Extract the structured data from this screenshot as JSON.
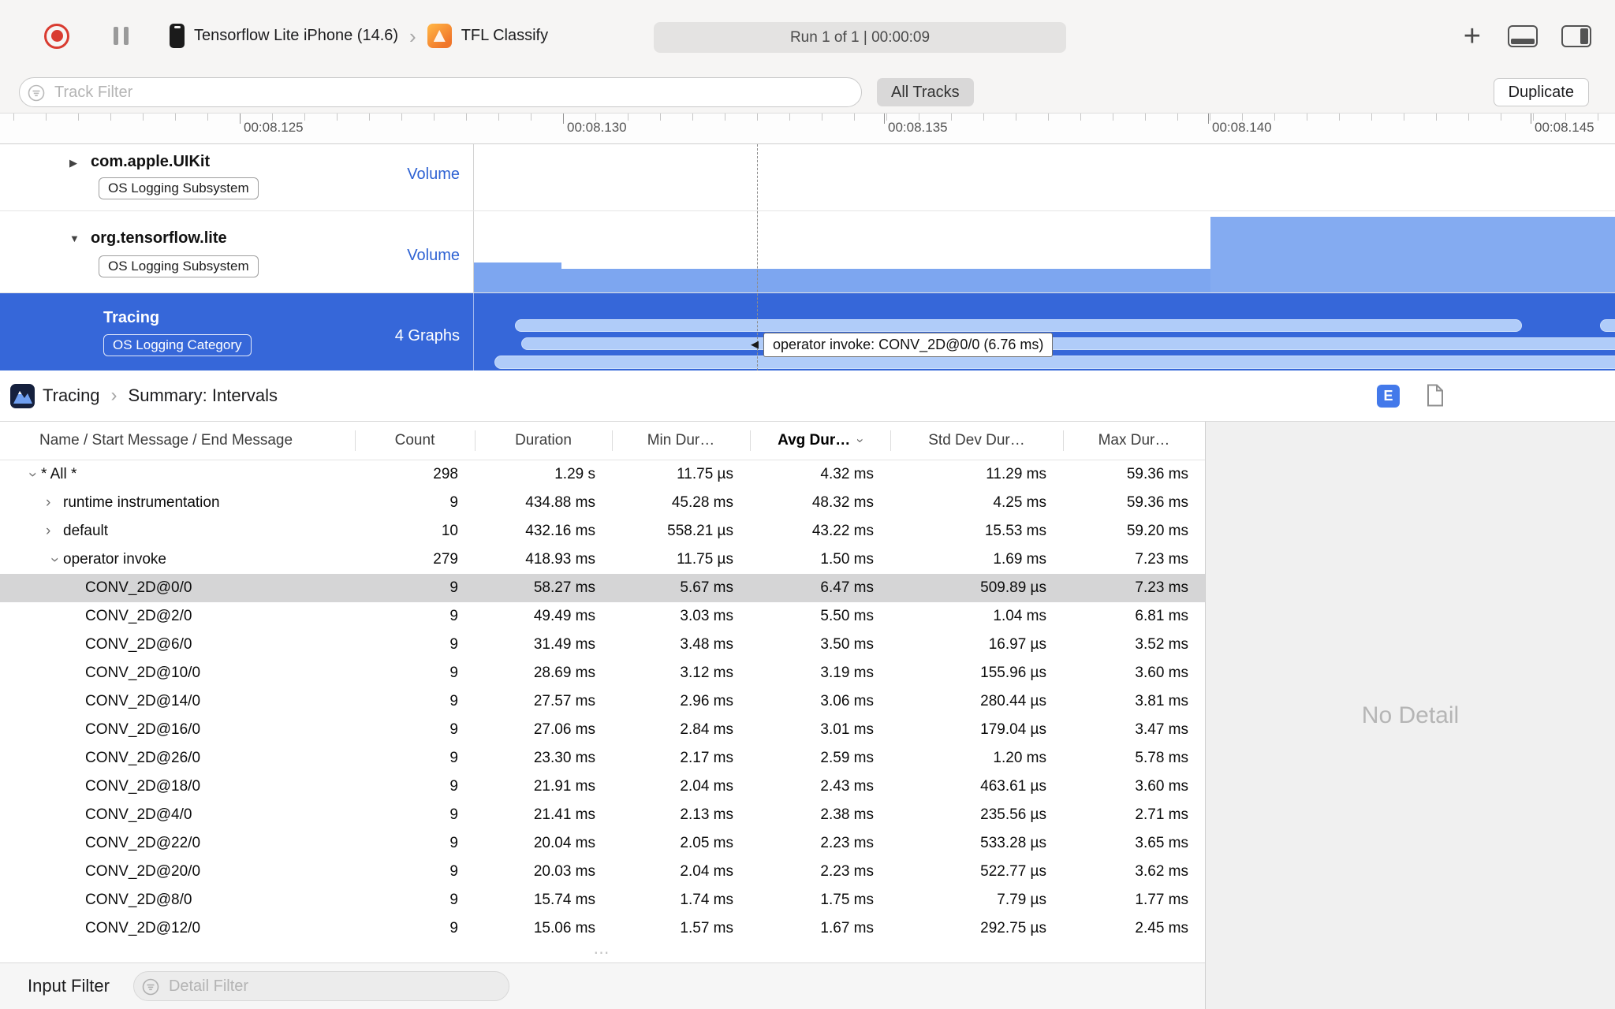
{
  "toolbar": {
    "device_name": "Tensorflow Lite iPhone (14.6)",
    "app_name": "TFL Classify",
    "run_status": "Run 1 of 1  |  00:00:09"
  },
  "filterbar": {
    "track_filter_placeholder": "Track Filter",
    "all_tracks_label": "All Tracks",
    "duplicate_label": "Duplicate"
  },
  "ruler": {
    "ticks": [
      "00:08.125",
      "00:08.130",
      "00:08.135",
      "00:08.140",
      "00:08.145"
    ]
  },
  "tracks": [
    {
      "name": "com.apple.UIKit",
      "badge": "OS Logging Subsystem",
      "meta": "Volume",
      "disclosure": "▶"
    },
    {
      "name": "org.tensorflow.lite",
      "badge": "OS Logging Subsystem",
      "meta": "Volume",
      "disclosure": "▼"
    },
    {
      "name": "Tracing",
      "badge": "OS Logging Category",
      "meta": "4 Graphs",
      "disclosure": ""
    }
  ],
  "timeline": {
    "tooltip": "operator invoke: CONV_2D@0/0 (6.76 ms)"
  },
  "breadcrumb": {
    "instrument": "Tracing",
    "detail": "Summary: Intervals",
    "inspector_button": "E"
  },
  "inspector": {
    "no_detail": "No Detail"
  },
  "statusbar": {
    "input_filter_label": "Input Filter",
    "detail_filter_placeholder": "Detail Filter"
  },
  "colors": {
    "selection_blue": "#3667d9",
    "graph_blue": "#7da6f0",
    "interval_blue": "#b0ccf9",
    "volume_label_blue": "#2e62d3",
    "record_red": "#d93b30"
  },
  "table": {
    "columns": [
      "Name / Start Message / End Message",
      "Count",
      "Duration",
      "Min Dur…",
      "Avg Dur…",
      "Std Dev Dur…",
      "Max Dur…"
    ],
    "sorted_column": "Avg Dur…",
    "rows": [
      {
        "indent": 0,
        "chev": "v",
        "name": "* All *",
        "count": "298",
        "duration": "1.29 s",
        "min": "11.75 µs",
        "avg": "4.32 ms",
        "std": "11.29 ms",
        "max": "59.36 ms",
        "selected": false
      },
      {
        "indent": 1,
        "chev": ">",
        "name": "runtime instrumentation",
        "count": "9",
        "duration": "434.88 ms",
        "min": "45.28 ms",
        "avg": "48.32 ms",
        "std": "4.25 ms",
        "max": "59.36 ms",
        "selected": false
      },
      {
        "indent": 1,
        "chev": ">",
        "name": "default",
        "count": "10",
        "duration": "432.16 ms",
        "min": "558.21 µs",
        "avg": "43.22 ms",
        "std": "15.53 ms",
        "max": "59.20 ms",
        "selected": false
      },
      {
        "indent": 1,
        "chev": "v",
        "name": "operator invoke",
        "count": "279",
        "duration": "418.93 ms",
        "min": "11.75 µs",
        "avg": "1.50 ms",
        "std": "1.69 ms",
        "max": "7.23 ms",
        "selected": false
      },
      {
        "indent": 2,
        "chev": "",
        "name": "CONV_2D@0/0",
        "count": "9",
        "duration": "58.27 ms",
        "min": "5.67 ms",
        "avg": "6.47 ms",
        "std": "509.89 µs",
        "max": "7.23 ms",
        "selected": true
      },
      {
        "indent": 2,
        "chev": "",
        "name": "CONV_2D@2/0",
        "count": "9",
        "duration": "49.49 ms",
        "min": "3.03 ms",
        "avg": "5.50 ms",
        "std": "1.04 ms",
        "max": "6.81 ms",
        "selected": false
      },
      {
        "indent": 2,
        "chev": "",
        "name": "CONV_2D@6/0",
        "count": "9",
        "duration": "31.49 ms",
        "min": "3.48 ms",
        "avg": "3.50 ms",
        "std": "16.97 µs",
        "max": "3.52 ms",
        "selected": false
      },
      {
        "indent": 2,
        "chev": "",
        "name": "CONV_2D@10/0",
        "count": "9",
        "duration": "28.69 ms",
        "min": "3.12 ms",
        "avg": "3.19 ms",
        "std": "155.96 µs",
        "max": "3.60 ms",
        "selected": false
      },
      {
        "indent": 2,
        "chev": "",
        "name": "CONV_2D@14/0",
        "count": "9",
        "duration": "27.57 ms",
        "min": "2.96 ms",
        "avg": "3.06 ms",
        "std": "280.44 µs",
        "max": "3.81 ms",
        "selected": false
      },
      {
        "indent": 2,
        "chev": "",
        "name": "CONV_2D@16/0",
        "count": "9",
        "duration": "27.06 ms",
        "min": "2.84 ms",
        "avg": "3.01 ms",
        "std": "179.04 µs",
        "max": "3.47 ms",
        "selected": false
      },
      {
        "indent": 2,
        "chev": "",
        "name": "CONV_2D@26/0",
        "count": "9",
        "duration": "23.30 ms",
        "min": "2.17 ms",
        "avg": "2.59 ms",
        "std": "1.20 ms",
        "max": "5.78 ms",
        "selected": false
      },
      {
        "indent": 2,
        "chev": "",
        "name": "CONV_2D@18/0",
        "count": "9",
        "duration": "21.91 ms",
        "min": "2.04 ms",
        "avg": "2.43 ms",
        "std": "463.61 µs",
        "max": "3.60 ms",
        "selected": false
      },
      {
        "indent": 2,
        "chev": "",
        "name": "CONV_2D@4/0",
        "count": "9",
        "duration": "21.41 ms",
        "min": "2.13 ms",
        "avg": "2.38 ms",
        "std": "235.56 µs",
        "max": "2.71 ms",
        "selected": false
      },
      {
        "indent": 2,
        "chev": "",
        "name": "CONV_2D@22/0",
        "count": "9",
        "duration": "20.04 ms",
        "min": "2.05 ms",
        "avg": "2.23 ms",
        "std": "533.28 µs",
        "max": "3.65 ms",
        "selected": false
      },
      {
        "indent": 2,
        "chev": "",
        "name": "CONV_2D@20/0",
        "count": "9",
        "duration": "20.03 ms",
        "min": "2.04 ms",
        "avg": "2.23 ms",
        "std": "522.77 µs",
        "max": "3.62 ms",
        "selected": false
      },
      {
        "indent": 2,
        "chev": "",
        "name": "CONV_2D@8/0",
        "count": "9",
        "duration": "15.74 ms",
        "min": "1.74 ms",
        "avg": "1.75 ms",
        "std": "7.79 µs",
        "max": "1.77 ms",
        "selected": false
      },
      {
        "indent": 2,
        "chev": "",
        "name": "CONV_2D@12/0",
        "count": "9",
        "duration": "15.06 ms",
        "min": "1.57 ms",
        "avg": "1.67 ms",
        "std": "292.75 µs",
        "max": "2.45 ms",
        "selected": false
      }
    ]
  }
}
